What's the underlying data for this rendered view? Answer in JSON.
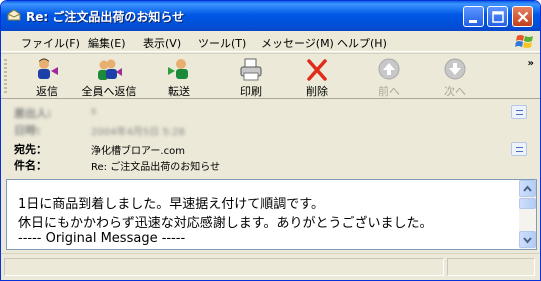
{
  "window": {
    "title": "Re: ご注文品出荷のお知らせ"
  },
  "menu": {
    "items": [
      "ファイル(F)",
      "編集(E)",
      "表示(V)",
      "ツール(T)",
      "メッセージ(M)",
      "ヘルプ(H)"
    ]
  },
  "toolbar": {
    "reply": "返信",
    "reply_all": "全員へ返信",
    "forward": "転送",
    "print": "印刷",
    "delete": "削除",
    "previous": "前へ",
    "next": "次へ",
    "overflow": "»"
  },
  "header": {
    "from_label_blurred": "差出人:",
    "from_value_blurred": "s",
    "date_label_blurred": "日時:",
    "date_value_blurred": "2004年4月5日 5:28",
    "to_label": "宛先：",
    "to_value": "浄化槽ブロアー.com",
    "subject_label": "件名：",
    "subject_value": "Re: ご注文品出荷のお知らせ"
  },
  "body": {
    "line1": "1日に商品到着しました。早速据え付けて順調です。",
    "line2": "休日にもかかわらず迅速な対応感謝します。ありがとうございました。",
    "line3": "----- Original Message -----"
  },
  "colors": {
    "titlebar": "#0058e6",
    "window_bg": "#ece9d8",
    "close_button": "#c0401c"
  }
}
